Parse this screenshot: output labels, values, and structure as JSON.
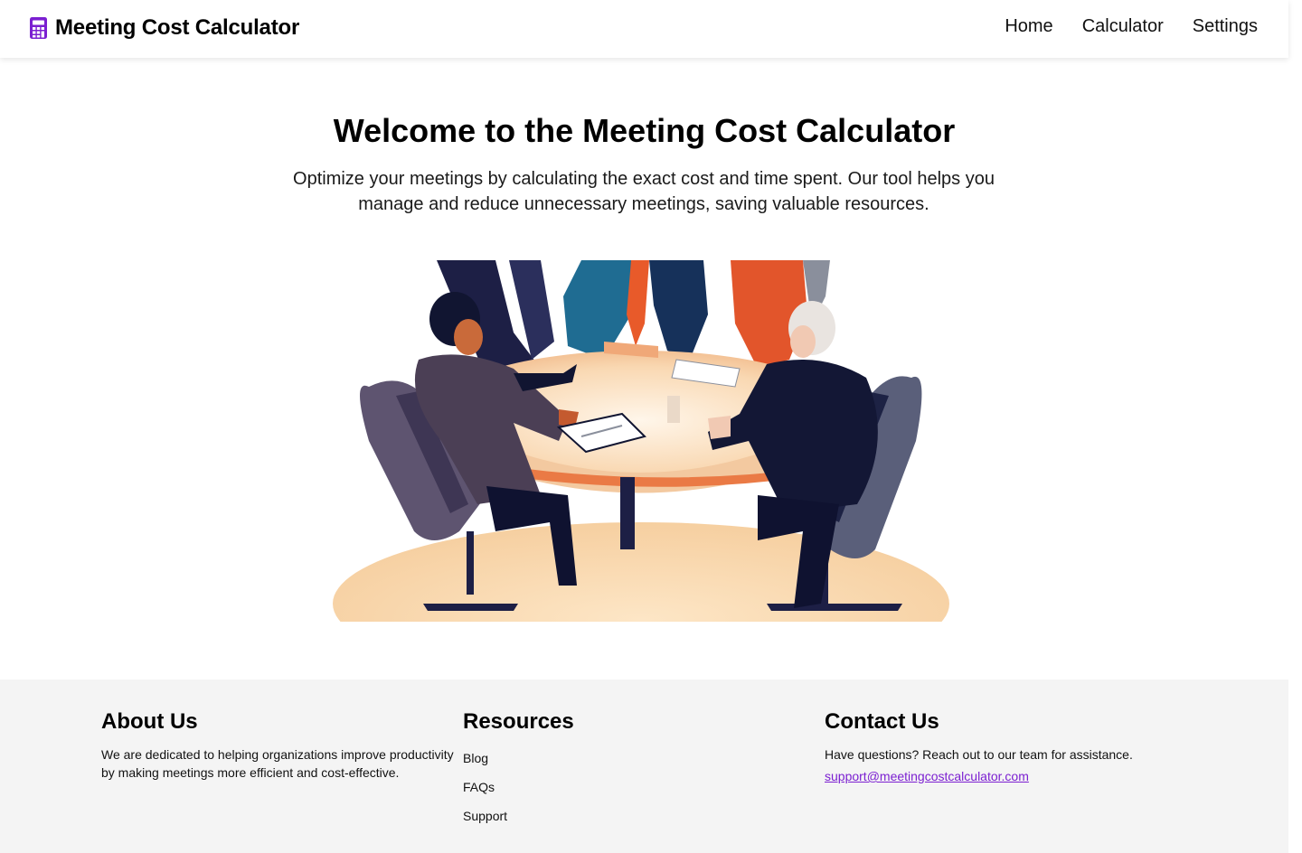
{
  "header": {
    "brand_title": "Meeting Cost Calculator",
    "brand_icon": "calculator-icon",
    "accent_color": "#7b1fd1",
    "nav": [
      {
        "label": "Home"
      },
      {
        "label": "Calculator"
      },
      {
        "label": "Settings"
      }
    ]
  },
  "hero": {
    "title": "Welcome to the Meeting Cost Calculator",
    "subtitle": "Optimize your meetings by calculating the exact cost and time spent. Our tool helps you manage and reduce unnecessary meetings, saving valuable resources."
  },
  "footer": {
    "about": {
      "heading": "About Us",
      "text": "We are dedicated to helping organizations improve productivity by making meetings more efficient and cost-effective."
    },
    "resources": {
      "heading": "Resources",
      "links": [
        {
          "label": "Blog"
        },
        {
          "label": "FAQs"
        },
        {
          "label": "Support"
        }
      ]
    },
    "contact": {
      "heading": "Contact Us",
      "text": "Have questions? Reach out to our team for assistance.",
      "email": "support@meetingcostcalculator.com"
    }
  }
}
